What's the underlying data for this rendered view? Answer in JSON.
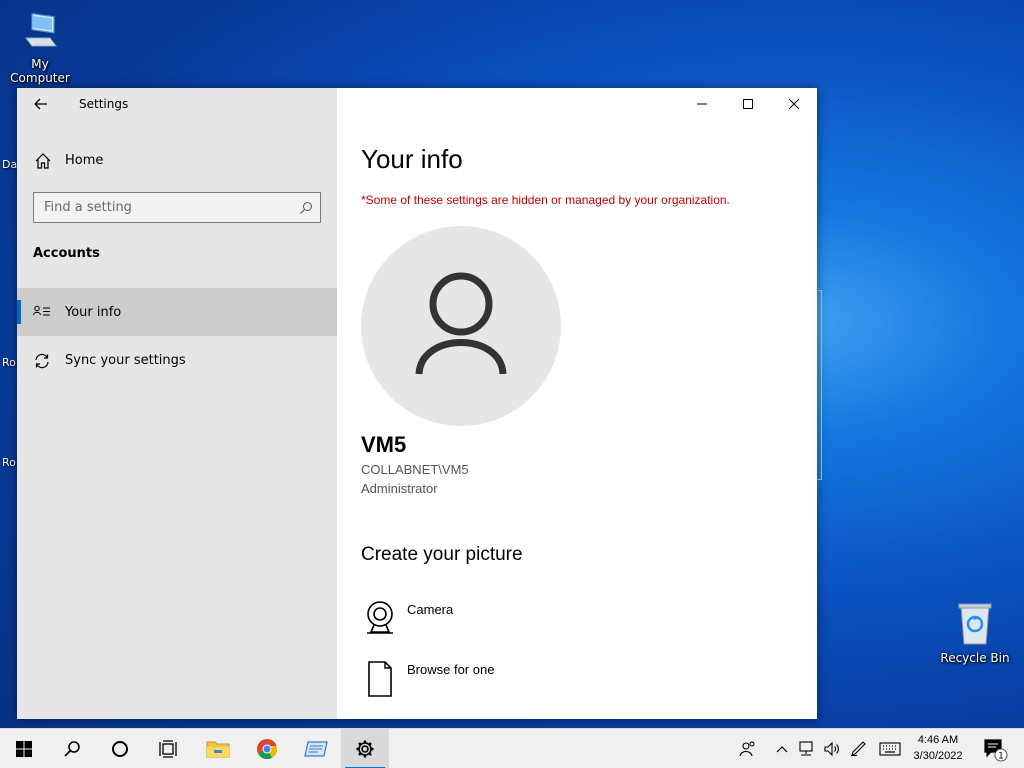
{
  "desktop": {
    "my_computer_label": "My Computer",
    "recycle_bin_label": "Recycle Bin",
    "edge_labels": [
      "Da",
      "Ro",
      "Ro"
    ]
  },
  "window": {
    "title": "Settings",
    "controls": [
      "minimize",
      "maximize",
      "close"
    ]
  },
  "nav": {
    "home_label": "Home",
    "search_placeholder": "Find a setting",
    "section_heading": "Accounts",
    "items": [
      {
        "label": "Your info",
        "icon": "contact-card-icon",
        "active": true
      },
      {
        "label": "Sync your settings",
        "icon": "sync-icon",
        "active": false
      }
    ]
  },
  "content": {
    "title": "Your info",
    "org_note": "*Some of these settings are hidden or managed by your organization.",
    "user": {
      "name": "VM5",
      "domain_account": "COLLABNET\\VM5",
      "role": "Administrator"
    },
    "create_picture_heading": "Create your picture",
    "options": [
      {
        "label": "Camera",
        "icon": "camera-icon"
      },
      {
        "label": "Browse for one",
        "icon": "file-icon"
      }
    ]
  },
  "taskbar": {
    "apps": [
      "start",
      "search",
      "cortana",
      "task-view",
      "file-explorer",
      "chrome",
      "server-manager",
      "settings"
    ],
    "time": "4:46 AM",
    "date": "3/30/2022",
    "notification_count": "1"
  },
  "colors": {
    "accent": "#0067c0",
    "warning_text": "#c00000",
    "nav_bg": "#e6e6e6"
  }
}
